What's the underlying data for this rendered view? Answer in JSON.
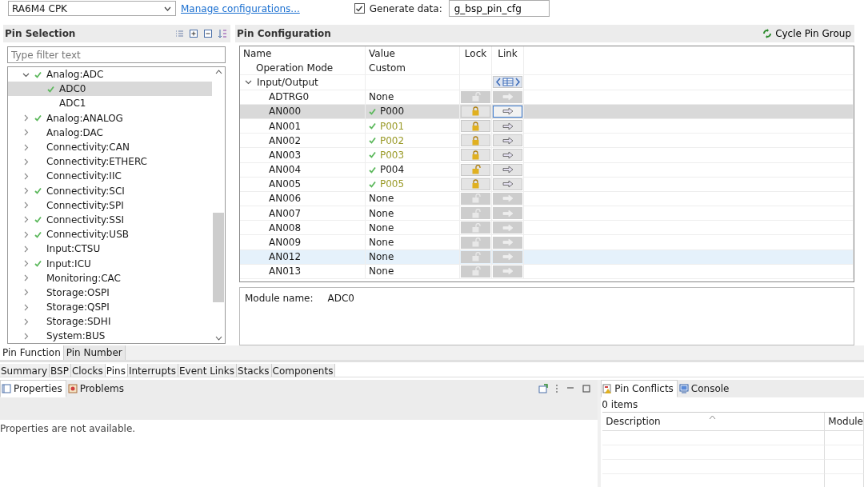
{
  "top_bar": {
    "board": "RA6M4 CPK",
    "manage_link": "Manage configurations...",
    "generate_data": {
      "label": "Generate data:",
      "checked": true,
      "value": "g_bsp_pin_cfg"
    }
  },
  "pin_selection": {
    "title": "Pin Selection",
    "filter_placeholder": "Type filter text",
    "tree": [
      {
        "label": "Analog:ADC",
        "checked": true,
        "expanded": true,
        "selected": false,
        "children": [
          {
            "label": "ADC0",
            "checked": true,
            "selected": true
          },
          {
            "label": "ADC1",
            "checked": false,
            "selected": false
          }
        ]
      },
      {
        "label": "Analog:ANALOG",
        "checked": true,
        "expanded": false,
        "selected": false
      },
      {
        "label": "Analog:DAC",
        "checked": false,
        "expanded": false,
        "selected": false
      },
      {
        "label": "Connectivity:CAN",
        "checked": false,
        "expanded": false,
        "selected": false
      },
      {
        "label": "Connectivity:ETHERC",
        "checked": false,
        "expanded": false,
        "selected": false
      },
      {
        "label": "Connectivity:IIC",
        "checked": false,
        "expanded": false,
        "selected": false
      },
      {
        "label": "Connectivity:SCI",
        "checked": true,
        "expanded": false,
        "selected": false
      },
      {
        "label": "Connectivity:SPI",
        "checked": false,
        "expanded": false,
        "selected": false
      },
      {
        "label": "Connectivity:SSI",
        "checked": true,
        "expanded": false,
        "selected": false
      },
      {
        "label": "Connectivity:USB",
        "checked": true,
        "expanded": false,
        "selected": false
      },
      {
        "label": "Input:CTSU",
        "checked": false,
        "expanded": false,
        "selected": false
      },
      {
        "label": "Input:ICU",
        "checked": true,
        "expanded": false,
        "selected": false
      },
      {
        "label": "Monitoring:CAC",
        "checked": false,
        "expanded": false,
        "selected": false
      },
      {
        "label": "Storage:OSPI",
        "checked": false,
        "expanded": false,
        "selected": false
      },
      {
        "label": "Storage:QSPI",
        "checked": false,
        "expanded": false,
        "selected": false
      },
      {
        "label": "Storage:SDHI",
        "checked": false,
        "expanded": false,
        "selected": false
      },
      {
        "label": "System:BUS",
        "checked": false,
        "expanded": false,
        "selected": false
      }
    ]
  },
  "pin_configuration": {
    "title": "Pin Configuration",
    "cycle_button": "Cycle Pin Group",
    "columns": [
      "Name",
      "Value",
      "Lock",
      "Link"
    ],
    "operation_mode": {
      "name": "Operation Mode",
      "value": "Custom"
    },
    "group": {
      "name": "Input/Output",
      "expanded": true
    },
    "rows": [
      {
        "name": "ADTRG0",
        "value": "None",
        "assigned": false,
        "disabled": true,
        "locked": false,
        "selected": false,
        "hovered": false
      },
      {
        "name": "AN000",
        "value": "P000",
        "assigned": true,
        "color": "#1a1a1a",
        "disabled": false,
        "locked": true,
        "selected": true,
        "hovered": false
      },
      {
        "name": "AN001",
        "value": "P001",
        "assigned": true,
        "color": "#9a9a28",
        "disabled": false,
        "locked": true,
        "selected": false,
        "hovered": false
      },
      {
        "name": "AN002",
        "value": "P002",
        "assigned": true,
        "color": "#9a9a28",
        "disabled": false,
        "locked": true,
        "selected": false,
        "hovered": false
      },
      {
        "name": "AN003",
        "value": "P003",
        "assigned": true,
        "color": "#9a9a28",
        "disabled": false,
        "locked": true,
        "selected": false,
        "hovered": false
      },
      {
        "name": "AN004",
        "value": "P004",
        "assigned": true,
        "color": "#1a1a1a",
        "disabled": false,
        "locked": false,
        "selected": false,
        "hovered": false
      },
      {
        "name": "AN005",
        "value": "P005",
        "assigned": true,
        "color": "#9a9a28",
        "disabled": false,
        "locked": true,
        "selected": false,
        "hovered": false
      },
      {
        "name": "AN006",
        "value": "None",
        "assigned": false,
        "disabled": true,
        "locked": false,
        "selected": false,
        "hovered": false
      },
      {
        "name": "AN007",
        "value": "None",
        "assigned": false,
        "disabled": true,
        "locked": false,
        "selected": false,
        "hovered": false
      },
      {
        "name": "AN008",
        "value": "None",
        "assigned": false,
        "disabled": true,
        "locked": false,
        "selected": false,
        "hovered": false
      },
      {
        "name": "AN009",
        "value": "None",
        "assigned": false,
        "disabled": true,
        "locked": false,
        "selected": false,
        "hovered": false
      },
      {
        "name": "AN012",
        "value": "None",
        "assigned": false,
        "disabled": true,
        "locked": false,
        "selected": false,
        "hovered": true
      },
      {
        "name": "AN013",
        "value": "None",
        "assigned": false,
        "disabled": true,
        "locked": false,
        "selected": false,
        "hovered": false
      }
    ],
    "module": {
      "label": "Module name:",
      "value": "ADC0"
    }
  },
  "view_tabs": [
    {
      "label": "Pin Function",
      "selected": true
    },
    {
      "label": "Pin Number",
      "selected": false
    }
  ],
  "editor_tabs": [
    {
      "label": "Summary",
      "selected": false
    },
    {
      "label": "BSP",
      "selected": false
    },
    {
      "label": "Clocks",
      "selected": false
    },
    {
      "label": "Pins",
      "selected": true
    },
    {
      "label": "Interrupts",
      "selected": false
    },
    {
      "label": "Event Links",
      "selected": false
    },
    {
      "label": "Stacks",
      "selected": false
    },
    {
      "label": "Components",
      "selected": false
    }
  ],
  "properties_view": {
    "tabs": [
      {
        "label": "Properties",
        "selected": true
      },
      {
        "label": "Problems",
        "selected": false
      }
    ],
    "message": "Properties are not available."
  },
  "conflicts_view": {
    "tabs": [
      {
        "label": "Pin Conflicts",
        "selected": true
      },
      {
        "label": "Console",
        "selected": false
      }
    ],
    "count": "0 items",
    "columns": [
      "Description",
      "Module"
    ]
  }
}
